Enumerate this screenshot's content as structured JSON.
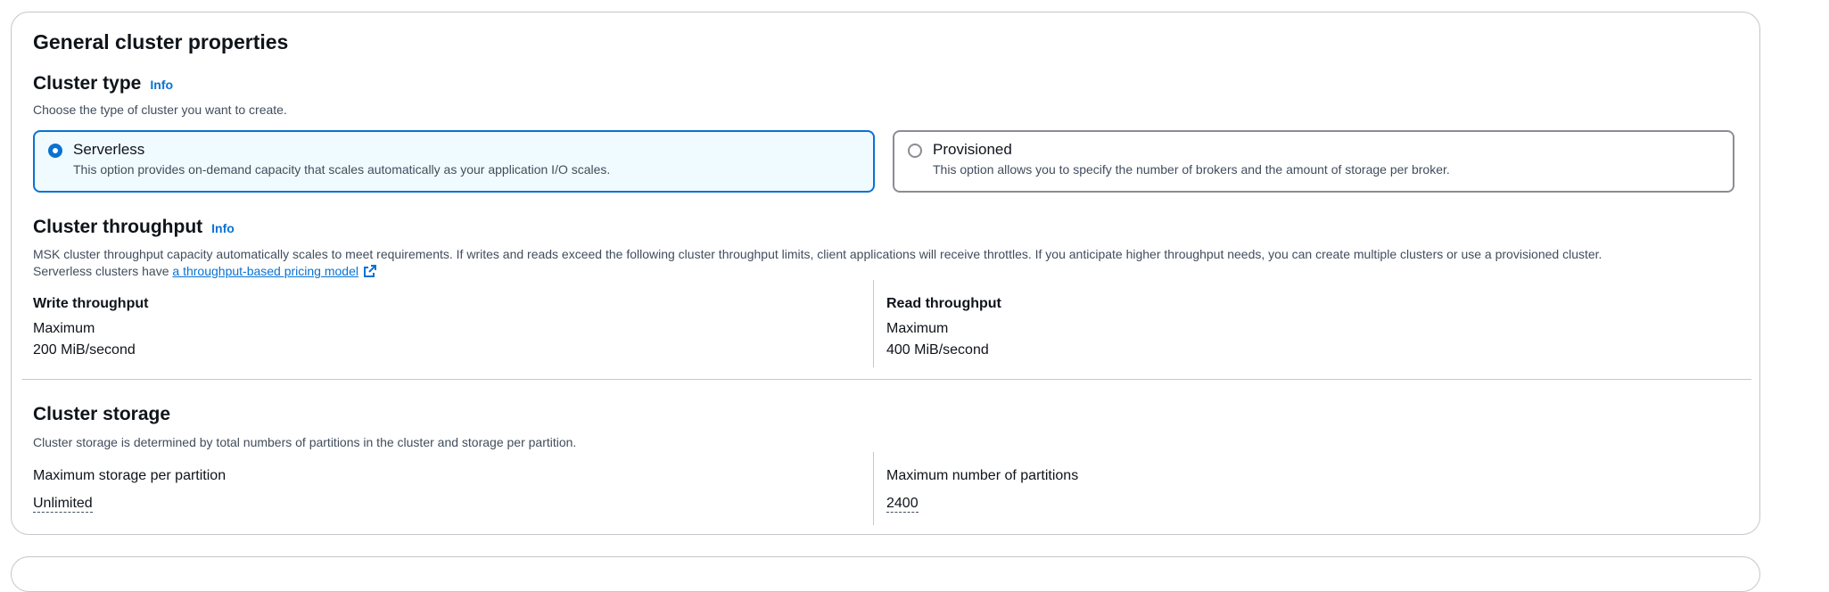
{
  "section": {
    "title": "General cluster properties"
  },
  "cluster_type": {
    "heading": "Cluster type",
    "info": "Info",
    "description": "Choose the type of cluster you want to create.",
    "options": [
      {
        "label": "Serverless",
        "description": "This option provides on-demand capacity that scales automatically as your application I/O scales.",
        "selected": true
      },
      {
        "label": "Provisioned",
        "description": "This option allows you to specify the number of brokers and the amount of storage per broker.",
        "selected": false
      }
    ]
  },
  "throughput": {
    "heading": "Cluster throughput",
    "info": "Info",
    "description_line1": "MSK cluster throughput capacity automatically scales to meet requirements. If writes and reads exceed the following cluster throughput limits, client applications will receive throttles. If you anticipate higher throughput needs, you can create multiple clusters or use a provisioned cluster.",
    "description_line2_prefix": "Serverless clusters have ",
    "pricing_link": "a throughput-based pricing model",
    "write": {
      "label": "Write throughput",
      "sub_label": "Maximum",
      "value": "200 MiB/second"
    },
    "read": {
      "label": "Read throughput",
      "sub_label": "Maximum",
      "value": "400 MiB/second"
    }
  },
  "storage": {
    "heading": "Cluster storage",
    "description": "Cluster storage is determined by total numbers of partitions in the cluster and storage per partition.",
    "per_partition": {
      "label": "Maximum storage per partition",
      "value": "Unlimited"
    },
    "partitions": {
      "label": "Maximum number of partitions",
      "value": "2400"
    }
  },
  "colors": {
    "accent": "#0972d3",
    "selected_bg": "#f0fbff",
    "border": "#c6c6cd",
    "text": "#0f141a",
    "muted": "#414d5c"
  },
  "icons": [
    "radio-selected-icon",
    "radio-unselected-icon",
    "external-link-icon"
  ]
}
